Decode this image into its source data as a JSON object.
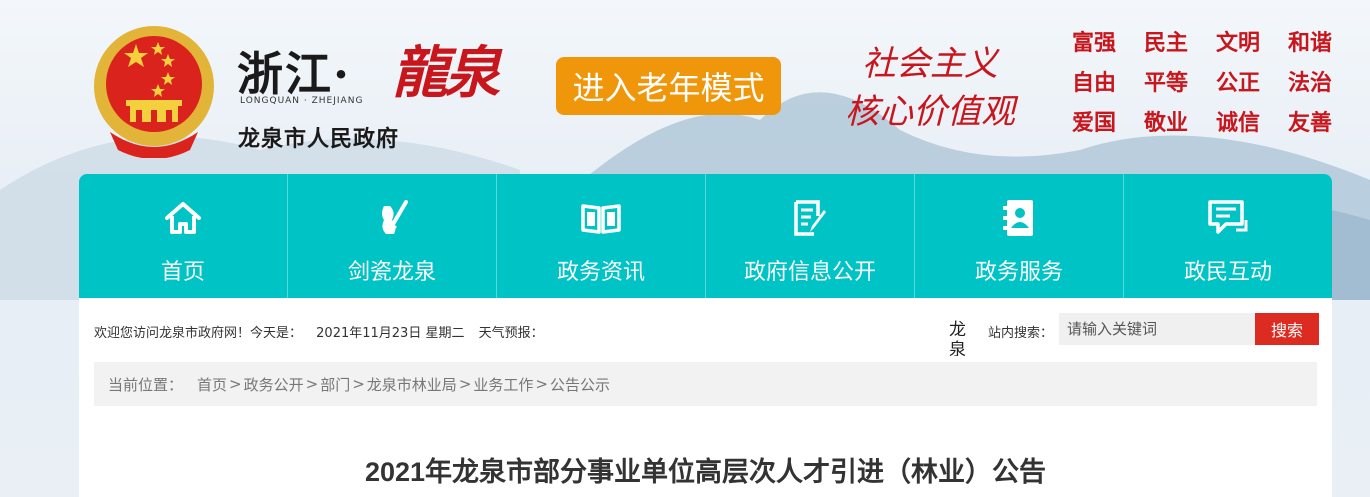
{
  "header": {
    "brand_cn": "浙江·",
    "brand_art": "龍泉",
    "brand_en": "LONGQUAN · ZHEJIANG",
    "gov_name": "龙泉市人民政府",
    "elder_mode": "进入老年模式",
    "slogan": [
      "社会主义",
      "核心价值观"
    ],
    "values": [
      "富强",
      "民主",
      "文明",
      "和谐",
      "自由",
      "平等",
      "公正",
      "法治",
      "爱国",
      "敬业",
      "诚信",
      "友善"
    ]
  },
  "nav": [
    {
      "label": "首页",
      "icon": "home-icon"
    },
    {
      "label": "剑瓷龙泉",
      "icon": "sword-vase-icon"
    },
    {
      "label": "政务资讯",
      "icon": "book-icon"
    },
    {
      "label": "政府信息公开",
      "icon": "document-edit-icon"
    },
    {
      "label": "政务服务",
      "icon": "contact-card-icon"
    },
    {
      "label": "政民互动",
      "icon": "chat-icon"
    }
  ],
  "infobar": {
    "welcome": "欢迎您访问龙泉市政府网！今天是：",
    "date": "2021年11月23日 星期二",
    "weather_label": "天气预报：",
    "weather_city": "龙泉",
    "search_label": "站内搜索：",
    "search_placeholder": "请输入关键词",
    "search_button": "搜索"
  },
  "breadcrumb": {
    "lead": "当前位置：",
    "items": [
      "首页",
      "政务公开",
      "部门",
      "龙泉市林业局",
      "业务工作",
      "公告公示"
    ],
    "separators": [
      " > ",
      "> ",
      "> ",
      "> ",
      "> "
    ]
  },
  "article": {
    "title": "2021年龙泉市部分事业单位高层次人才引进（林业）公告"
  },
  "colors": {
    "nav_bg": "#00c3c6",
    "elder_btn": "#f0960a",
    "accent_red": "#c8161d",
    "search_btn": "#dc2c22"
  }
}
